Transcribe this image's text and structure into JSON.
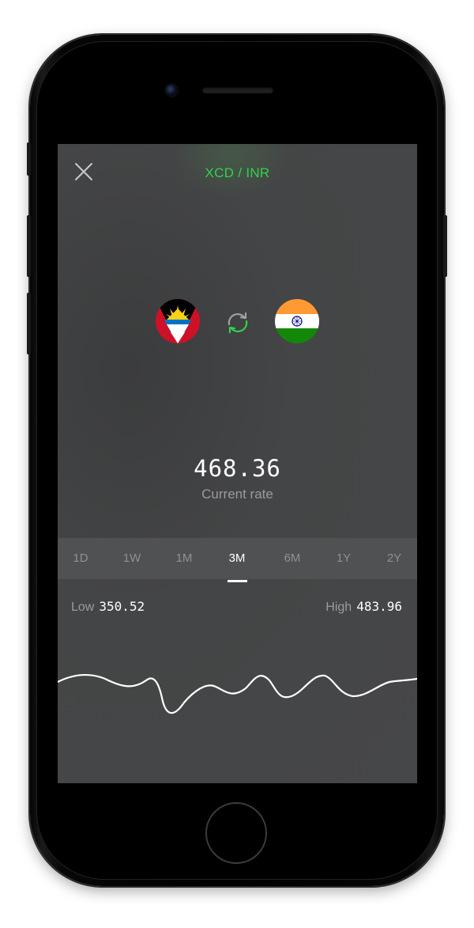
{
  "header": {
    "title": "XCD / INR"
  },
  "pair": {
    "from_flag": "antigua-and-barbuda-flag",
    "to_flag": "india-flag",
    "swap_icon": "swap-arrows-icon"
  },
  "rate": {
    "value": "468.36",
    "label": "Current rate"
  },
  "tabs": [
    {
      "label": "1D"
    },
    {
      "label": "1W"
    },
    {
      "label": "1M"
    },
    {
      "label": "3M"
    },
    {
      "label": "6M"
    },
    {
      "label": "1Y"
    },
    {
      "label": "2Y"
    }
  ],
  "active_tab": "3M",
  "stats": {
    "low_label": "Low",
    "low_value": "350.52",
    "high_label": "High",
    "high_value": "483.96"
  },
  "colors": {
    "accent": "#2fd34a",
    "background": "#464748",
    "tab_bar": "#505152"
  }
}
